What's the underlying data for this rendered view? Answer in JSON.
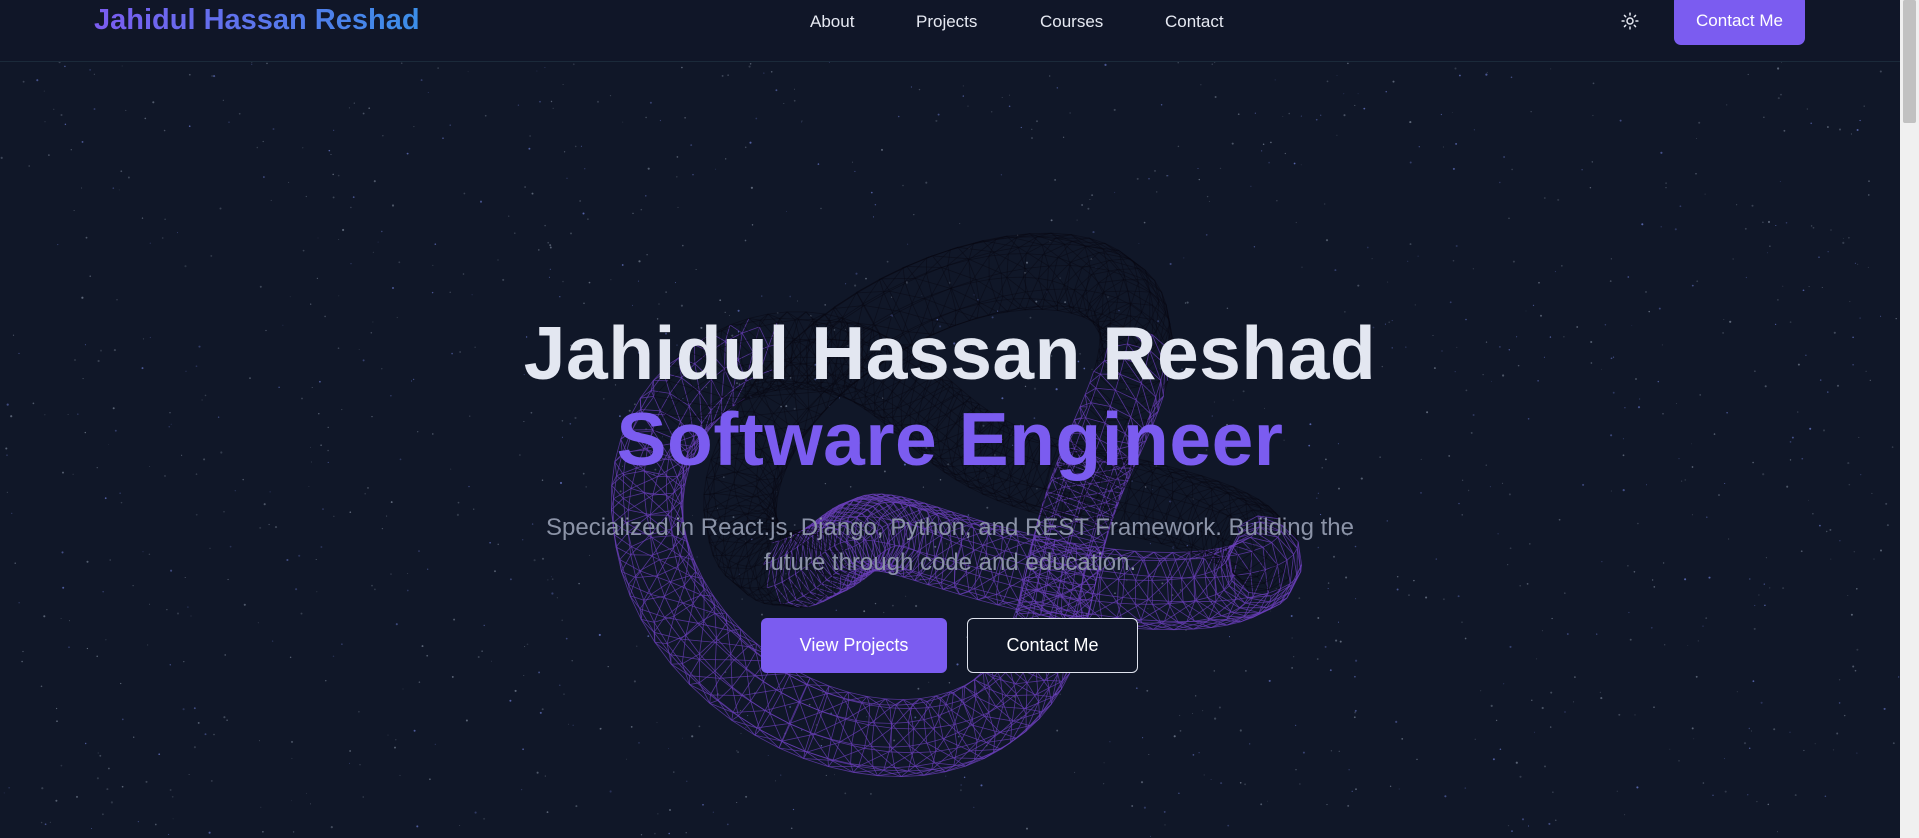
{
  "nav": {
    "brand": "Jahidul Hassan Reshad",
    "links": [
      "About",
      "Projects",
      "Courses",
      "Contact"
    ],
    "theme_toggle_icon": "sun-icon",
    "cta_label": "Contact Me"
  },
  "hero": {
    "title": "Jahidul Hassan Reshad",
    "subtitle": "Software Engineer",
    "description": "Specialized in React.js, Django, Python, and REST Framework. Building the future through code and education.",
    "primary_button": "View Projects",
    "secondary_button": "Contact Me"
  },
  "colors": {
    "background": "#101728",
    "accent": "#7b5cf0",
    "brand_gradient_end": "#3b8ee8",
    "text_primary": "#e3e7f1",
    "text_muted": "#8b93a7"
  }
}
